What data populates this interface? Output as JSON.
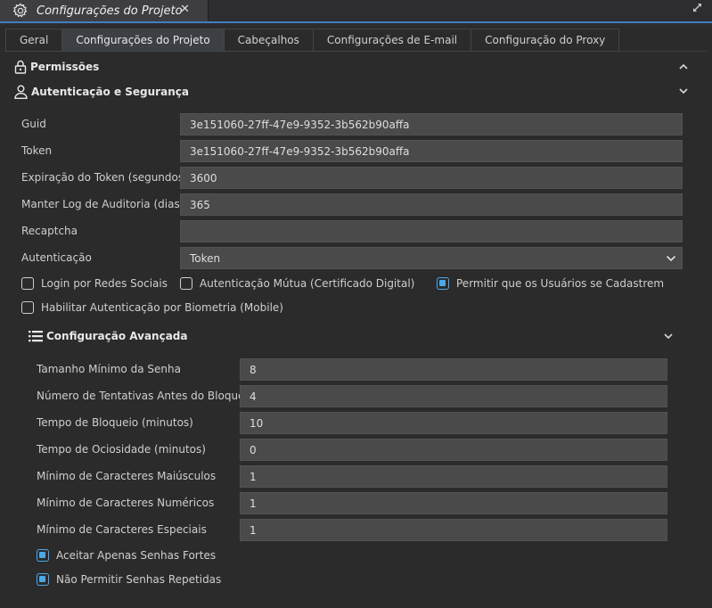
{
  "document_tab": {
    "title": "Configurações do Projeto",
    "close_label": "✕"
  },
  "tabs": [
    {
      "label": "Geral"
    },
    {
      "label": "Configurações do Projeto"
    },
    {
      "label": "Cabeçalhos"
    },
    {
      "label": "Configurações de E-mail"
    },
    {
      "label": "Configuração do Proxy"
    }
  ],
  "sections": {
    "permissions": {
      "title": "Permissões",
      "icon": "lock-icon",
      "state": "collapsed"
    },
    "auth": {
      "title": "Autenticação e Segurança",
      "icon": "user-icon",
      "state": "expanded"
    },
    "advanced": {
      "title": "Configuração Avançada",
      "icon": "list-icon",
      "state": "expanded"
    }
  },
  "auth_fields": {
    "guid": {
      "label": "Guid",
      "value": "3e151060-27ff-47e9-9352-3b562b90affa"
    },
    "token": {
      "label": "Token",
      "value": "3e151060-27ff-47e9-9352-3b562b90affa"
    },
    "token_expiry": {
      "label": "Expiração do Token (segundos)",
      "value": "3600"
    },
    "audit_log": {
      "label": "Manter Log de Auditoria (dias)",
      "value": "365"
    },
    "recaptcha": {
      "label": "Recaptcha",
      "value": ""
    },
    "authentication": {
      "label": "Autenticação",
      "value": "Token"
    }
  },
  "auth_checks": {
    "social_login": {
      "label": "Login por Redes Sociais",
      "checked": false
    },
    "mutual_auth": {
      "label": "Autenticação Mútua (Certificado Digital)",
      "checked": false
    },
    "allow_signup": {
      "label": "Permitir que os Usuários se Cadastrem",
      "checked": true
    },
    "biometrics": {
      "label": "Habilitar Autenticação por Biometria (Mobile)",
      "checked": false
    }
  },
  "advanced_fields": {
    "min_password": {
      "label": "Tamanho Mínimo da Senha",
      "value": "8"
    },
    "attempts": {
      "label": "Número de Tentativas Antes do Bloqueio",
      "value": "4"
    },
    "lock_time": {
      "label": "Tempo de Bloqueio (minutos)",
      "value": "10"
    },
    "idle_time": {
      "label": "Tempo de Ociosidade (minutos)",
      "value": "0"
    },
    "min_upper": {
      "label": "Mínimo de Caracteres Maiúsculos",
      "value": "1"
    },
    "min_numeric": {
      "label": "Mínimo de Caracteres Numéricos",
      "value": "1"
    },
    "min_special": {
      "label": "Mínimo de Caracteres Especiais",
      "value": "1"
    }
  },
  "advanced_checks": {
    "strong_only": {
      "label": "Aceitar Apenas Senhas Fortes",
      "checked": true
    },
    "no_repeat": {
      "label": "Não Permitir Senhas Repetidas",
      "checked": true
    }
  },
  "colors": {
    "accent": "#4aa8e8",
    "field_bg": "#4a4a4a",
    "panel_bg": "#2b2b2b"
  }
}
